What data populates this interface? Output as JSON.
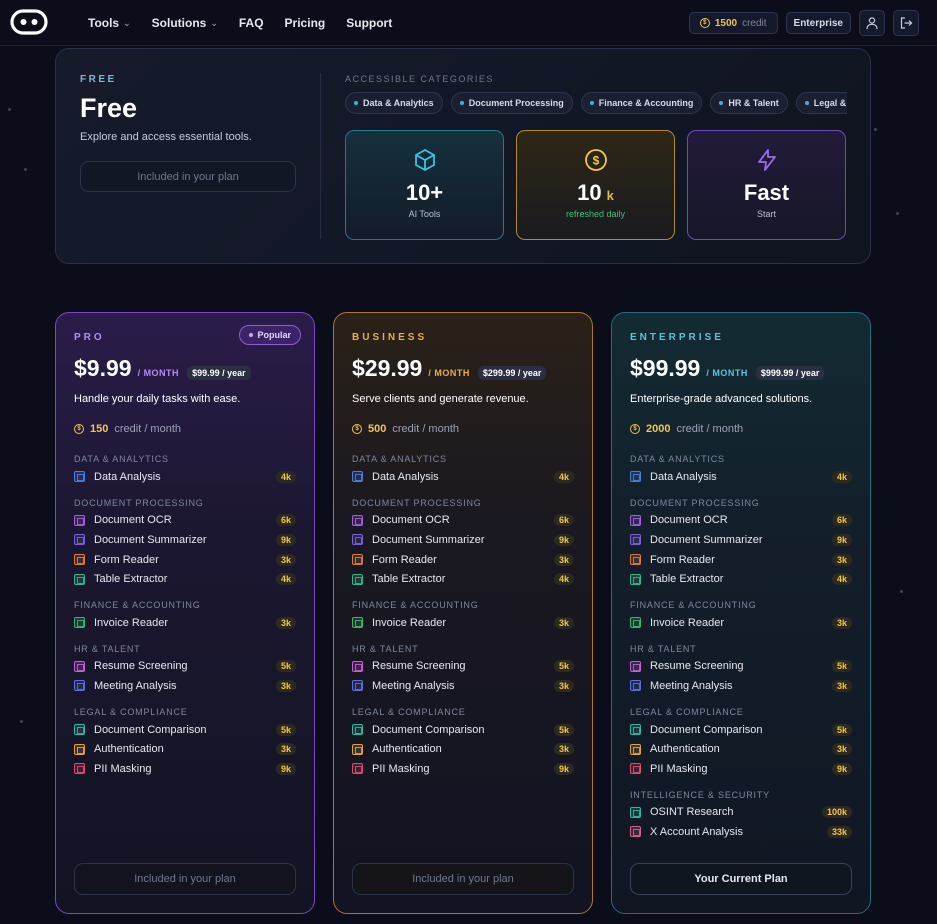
{
  "nav": {
    "links": [
      {
        "label": "Tools",
        "dropdown": true
      },
      {
        "label": "Solutions",
        "dropdown": true
      },
      {
        "label": "FAQ",
        "dropdown": false
      },
      {
        "label": "Pricing",
        "dropdown": false
      },
      {
        "label": "Support",
        "dropdown": false
      }
    ],
    "credit_amount": "1500",
    "credit_label": "credit",
    "plan_badge": "Enterprise"
  },
  "free": {
    "label": "FREE",
    "title": "Free",
    "description": "Explore and access essential tools.",
    "button": "Included in your plan",
    "categories_label": "ACCESSIBLE CATEGORIES",
    "categories": [
      "Data & Analytics",
      "Document Processing",
      "Finance & Accounting",
      "HR & Talent",
      "Legal & Compliance"
    ],
    "stats": [
      {
        "value": "10+",
        "unit": "",
        "sub": "AI Tools",
        "icon": "cube-icon",
        "color": "#38c4e6"
      },
      {
        "value": "10",
        "unit": "k",
        "sub": "refreshed daily",
        "icon": "coin-icon",
        "color": "#f3c646"
      },
      {
        "value": "Fast",
        "unit": "",
        "sub": "Start",
        "icon": "lightning-icon",
        "color": "#9b6cf0"
      }
    ]
  },
  "plans": [
    {
      "name": "PRO",
      "popular": "Popular",
      "price": "$9.99",
      "per": "/ MONTH",
      "year": "$99.99 / year",
      "description": "Handle your daily tasks with ease.",
      "credits": "150",
      "credit_label": "credit / month",
      "button": "Included in your plan",
      "accent": "#b48ef0",
      "sections": [
        {
          "title": "DATA & ANALYTICS",
          "items": [
            {
              "name": "Data Analysis",
              "count": "4k",
              "color": "#4a7ee0"
            }
          ]
        },
        {
          "title": "DOCUMENT PROCESSING",
          "items": [
            {
              "name": "Document OCR",
              "count": "6k",
              "color": "#a35ee0"
            },
            {
              "name": "Document Summarizer",
              "count": "9k",
              "color": "#7a5ee0"
            },
            {
              "name": "Form Reader",
              "count": "3k",
              "color": "#e07a3a"
            },
            {
              "name": "Table Extractor",
              "count": "4k",
              "color": "#2fb88a"
            }
          ]
        },
        {
          "title": "FINANCE & ACCOUNTING",
          "items": [
            {
              "name": "Invoice Reader",
              "count": "3k",
              "color": "#3ab86a"
            }
          ]
        },
        {
          "title": "HR & TALENT",
          "items": [
            {
              "name": "Resume Screening",
              "count": "5k",
              "color": "#c85ed6"
            },
            {
              "name": "Meeting Analysis",
              "count": "3k",
              "color": "#5e6ee0"
            }
          ]
        },
        {
          "title": "LEGAL & COMPLIANCE",
          "items": [
            {
              "name": "Document Comparison",
              "count": "5k",
              "color": "#2fb8a0"
            },
            {
              "name": "Authentication",
              "count": "3k",
              "color": "#e0a23a"
            },
            {
              "name": "PII Masking",
              "count": "9k",
              "color": "#e04a6a"
            }
          ]
        }
      ]
    },
    {
      "name": "BUSINESS",
      "popular": "",
      "price": "$29.99",
      "per": "/ MONTH",
      "year": "$299.99 / year",
      "description": "Serve clients and generate revenue.",
      "credits": "500",
      "credit_label": "credit / month",
      "button": "Included in your plan",
      "accent": "#e3b14a",
      "sections": [
        {
          "title": "DATA & ANALYTICS",
          "items": [
            {
              "name": "Data Analysis",
              "count": "4k",
              "color": "#4a7ee0"
            }
          ]
        },
        {
          "title": "DOCUMENT PROCESSING",
          "items": [
            {
              "name": "Document OCR",
              "count": "6k",
              "color": "#a35ee0"
            },
            {
              "name": "Document Summarizer",
              "count": "9k",
              "color": "#7a5ee0"
            },
            {
              "name": "Form Reader",
              "count": "3k",
              "color": "#e07a3a"
            },
            {
              "name": "Table Extractor",
              "count": "4k",
              "color": "#2fb88a"
            }
          ]
        },
        {
          "title": "FINANCE & ACCOUNTING",
          "items": [
            {
              "name": "Invoice Reader",
              "count": "3k",
              "color": "#3ab86a"
            }
          ]
        },
        {
          "title": "HR & TALENT",
          "items": [
            {
              "name": "Resume Screening",
              "count": "5k",
              "color": "#c85ed6"
            },
            {
              "name": "Meeting Analysis",
              "count": "3k",
              "color": "#5e6ee0"
            }
          ]
        },
        {
          "title": "LEGAL & COMPLIANCE",
          "items": [
            {
              "name": "Document Comparison",
              "count": "5k",
              "color": "#2fb8a0"
            },
            {
              "name": "Authentication",
              "count": "3k",
              "color": "#e0a23a"
            },
            {
              "name": "PII Masking",
              "count": "9k",
              "color": "#e04a6a"
            }
          ]
        }
      ]
    },
    {
      "name": "ENTERPRISE",
      "popular": "",
      "price": "$99.99",
      "per": "/ MONTH",
      "year": "$999.99 / year",
      "description": "Enterprise-grade advanced solutions.",
      "credits": "2000",
      "credit_label": "credit / month",
      "button": "Your Current Plan",
      "accent": "#5cc4d6",
      "sections": [
        {
          "title": "DATA & ANALYTICS",
          "items": [
            {
              "name": "Data Analysis",
              "count": "4k",
              "color": "#4a7ee0"
            }
          ]
        },
        {
          "title": "DOCUMENT PROCESSING",
          "items": [
            {
              "name": "Document OCR",
              "count": "6k",
              "color": "#a35ee0"
            },
            {
              "name": "Document Summarizer",
              "count": "9k",
              "color": "#7a5ee0"
            },
            {
              "name": "Form Reader",
              "count": "3k",
              "color": "#e07a3a"
            },
            {
              "name": "Table Extractor",
              "count": "4k",
              "color": "#2fb88a"
            }
          ]
        },
        {
          "title": "FINANCE & ACCOUNTING",
          "items": [
            {
              "name": "Invoice Reader",
              "count": "3k",
              "color": "#3ab86a"
            }
          ]
        },
        {
          "title": "HR & TALENT",
          "items": [
            {
              "name": "Resume Screening",
              "count": "5k",
              "color": "#c85ed6"
            },
            {
              "name": "Meeting Analysis",
              "count": "3k",
              "color": "#5e6ee0"
            }
          ]
        },
        {
          "title": "LEGAL & COMPLIANCE",
          "items": [
            {
              "name": "Document Comparison",
              "count": "5k",
              "color": "#2fb8a0"
            },
            {
              "name": "Authentication",
              "count": "3k",
              "color": "#e0a23a"
            },
            {
              "name": "PII Masking",
              "count": "9k",
              "color": "#e04a6a"
            }
          ]
        },
        {
          "title": "INTELLIGENCE & SECURITY",
          "items": [
            {
              "name": "OSINT Research",
              "count": "100k",
              "color": "#2fb8a0"
            },
            {
              "name": "X Account Analysis",
              "count": "33k",
              "color": "#d65e8a"
            }
          ]
        }
      ]
    }
  ]
}
